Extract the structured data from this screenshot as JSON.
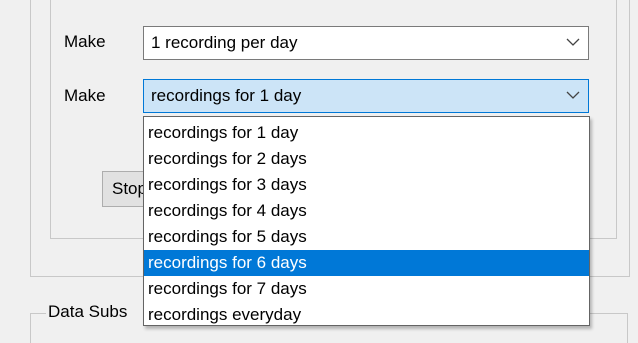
{
  "rows": [
    {
      "label": "Make",
      "value": "1 recording per day"
    },
    {
      "label": "Make",
      "value": "recordings for 1 day"
    }
  ],
  "stop_button": {
    "label": "Stop"
  },
  "dropdown": {
    "options": [
      "recordings for 1 day",
      "recordings for 2 days",
      "recordings for 3 days",
      "recordings for 4 days",
      "recordings for 5 days",
      "recordings for 6 days",
      "recordings for 7 days",
      "recordings everyday"
    ],
    "highlighted": "recordings for 6 days"
  },
  "groupbox": {
    "label": "Data Subs"
  },
  "colors": {
    "highlight": "#0078d7",
    "active_combo": "#cce4f7"
  }
}
